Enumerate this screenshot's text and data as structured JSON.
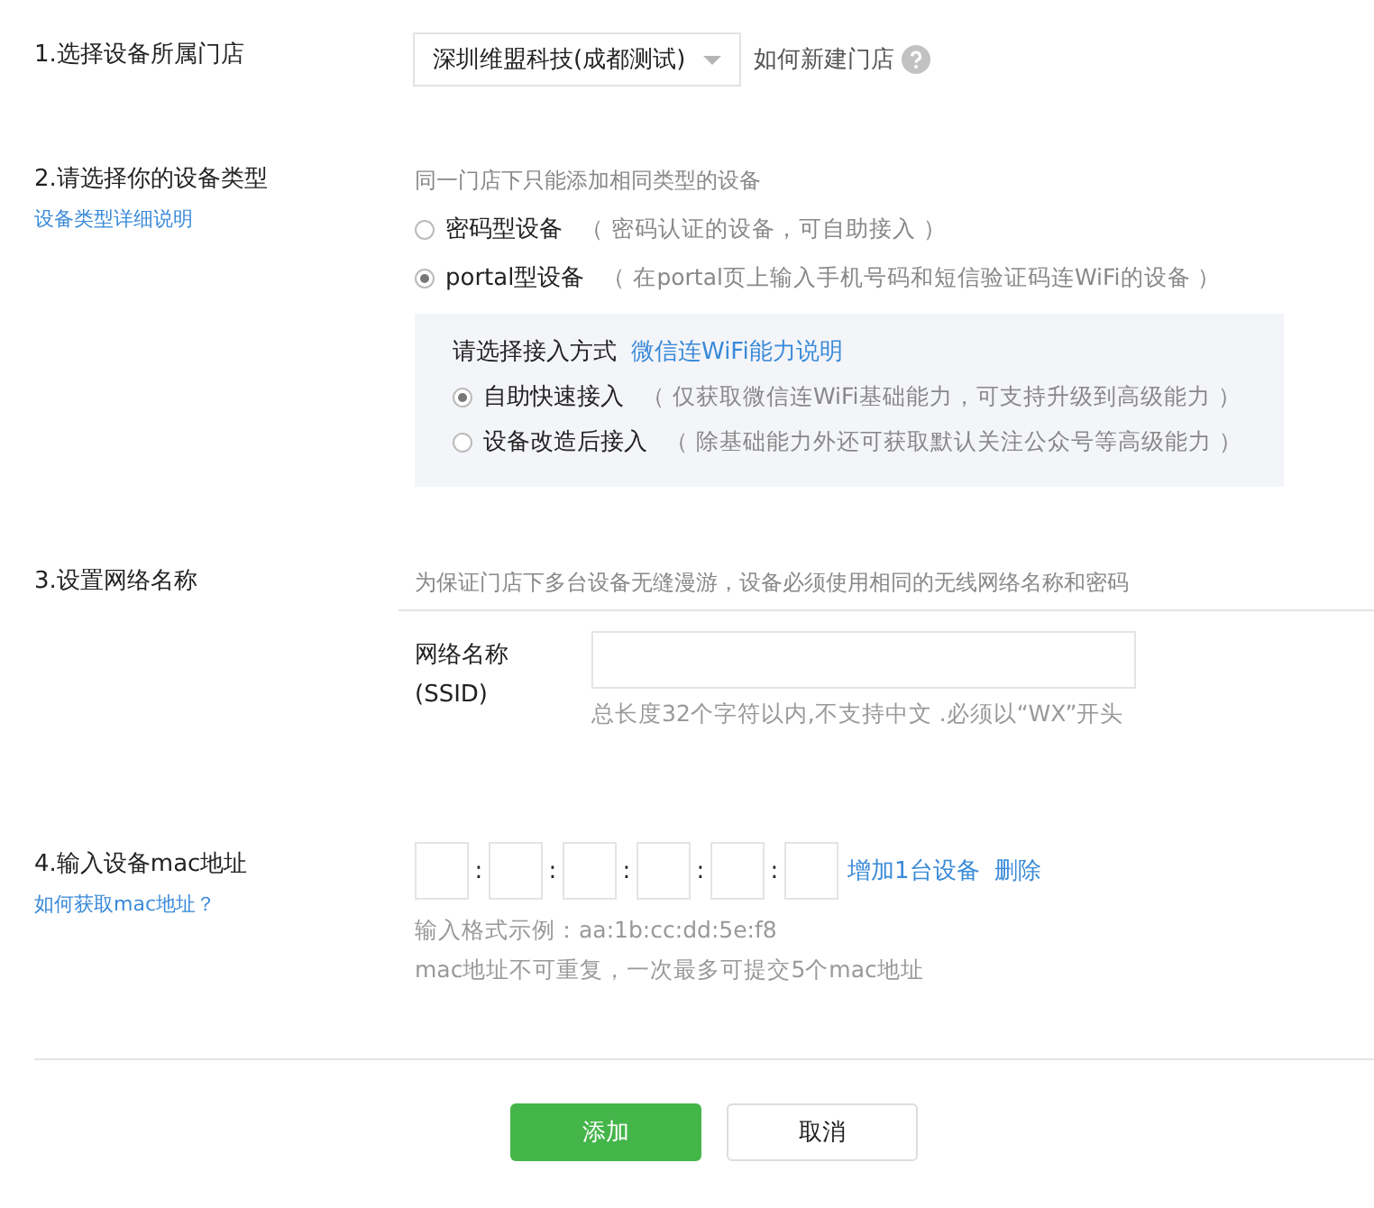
{
  "sections": [
    {
      "title": "1.选择设备所属门店",
      "kind": "store",
      "store_select": {
        "value": "深圳维盟科技(成都测试)"
      },
      "help_link": "如何新建门店"
    },
    {
      "title": "2.请选择你的设备类型",
      "kind": "type",
      "side_link": "设备类型详细说明",
      "note": "同一门店下只能添加相同类型的设备",
      "options": [
        {
          "label": "密码型设备",
          "desc": "（ 密码认证的设备，可自助接入 ）",
          "selected": false
        },
        {
          "label": "portal型设备",
          "desc": "（ 在portal页上输入手机号码和短信验证码连WiFi的设备 ）",
          "selected": true
        }
      ],
      "access": {
        "title": "请选择接入方式",
        "link": "微信连WiFi能力说明",
        "options": [
          {
            "label": "自助快速接入",
            "desc": "（ 仅获取微信连WiFi基础能力，可支持升级到高级能力 ）",
            "selected": true
          },
          {
            "label": "设备改造后接入",
            "desc": "（ 除基础能力外还可获取默认关注公众号等高级能力 ）",
            "selected": false
          }
        ]
      }
    },
    {
      "title": "3.设置网络名称",
      "kind": "ssid",
      "note": "为保证门店下多台设备无缝漫游，设备必须使用相同的无线网络名称和密码",
      "field_label": "网络名称\n(SSID)",
      "hint": "总长度32个字符以内,不支持中文 .必须以“WX”开头"
    },
    {
      "title": "4.输入设备mac地址",
      "kind": "mac",
      "side_link": "如何获取mac地址？",
      "separators": [
        ":",
        ":",
        ":",
        ":",
        ":"
      ],
      "add_link": "增加1台设备",
      "delete_link": "删除",
      "hints": [
        "输入格式示例：aa:1b:cc:dd:5e:f8",
        "mac地址不可重复，一次最多可提交5个mac地址"
      ]
    }
  ],
  "buttons": [
    {
      "label": "添加",
      "kind": "primary"
    },
    {
      "label": "取消",
      "kind": "default"
    }
  ]
}
